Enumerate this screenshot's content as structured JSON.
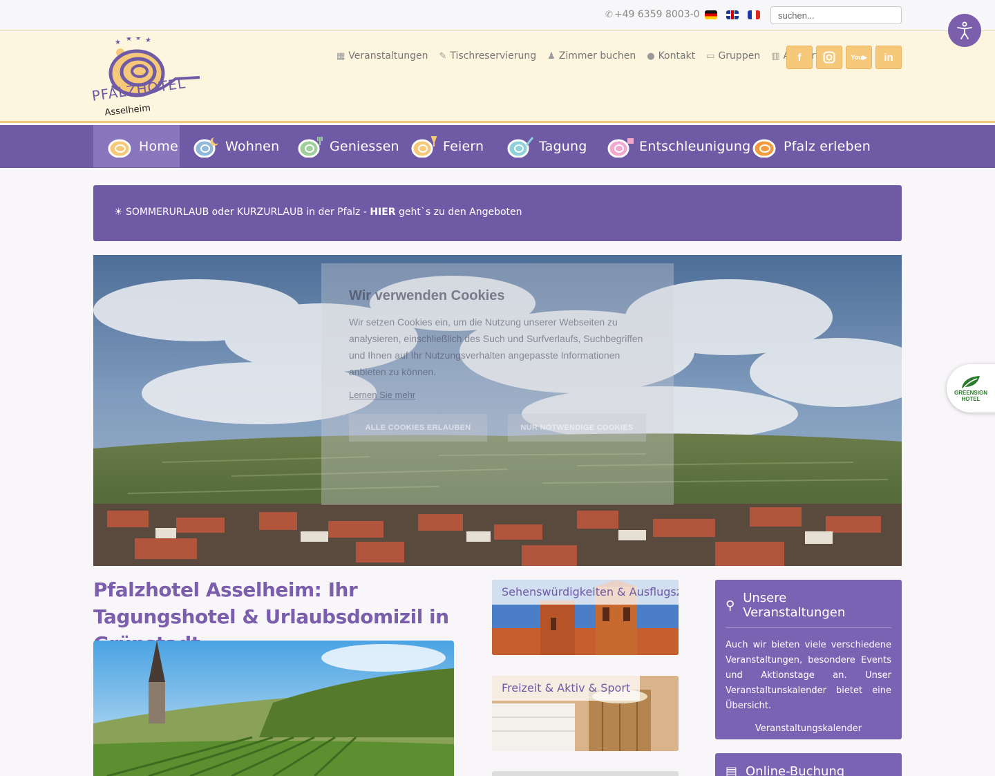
{
  "topbar": {
    "phone": "+49 6359 8003-0",
    "languages": [
      "de",
      "en",
      "fr"
    ],
    "search_placeholder": "suchen..."
  },
  "brand": {
    "line1": "PFALZHOTEL",
    "line2": "Asselheim"
  },
  "subnav": [
    {
      "label": "Veranstaltungen",
      "icon": "calendar-icon"
    },
    {
      "label": "Tischreservierung",
      "icon": "pencil-icon"
    },
    {
      "label": "Zimmer buchen",
      "icon": "user-icon"
    },
    {
      "label": "Kontakt",
      "icon": "chat-icon"
    },
    {
      "label": "Gruppen",
      "icon": "picture-icon"
    },
    {
      "label": "Anfahrt",
      "icon": "map-icon"
    }
  ],
  "social": [
    "facebook-icon",
    "instagram-icon",
    "youtube-icon",
    "linkedin-icon"
  ],
  "mainnav": [
    "Home",
    "Wohnen",
    "Geniessen",
    "Feiern",
    "Tagung",
    "Entschleunigung",
    "Pfalz erleben"
  ],
  "banner": {
    "glyph": "",
    "sun": "☀",
    "text_pre": "SOMMERURLAUB oder KURZURLAUB in der Pfalz - ",
    "text_bold": "HIER",
    "text_post": " geht`s zu den Angeboten"
  },
  "cookie": {
    "title": "Wir verwenden Cookies",
    "body": "Wir setzen Cookies ein, um die Nutzung unserer Webseiten zu analysieren, einschließlich des Such und Surfverlaufs, Suchbegriffen und Ihnen auf Ihr Nutzungsverhalten angepasste Informationen anbieten zu können.",
    "learn_more": "Lernen Sie mehr",
    "allow_all": "ALLE COOKIES ERLAUBEN",
    "necessary_only": "NUR NOTWENDIGE COOKIES"
  },
  "main": {
    "heading": "Pfalzhotel Asselheim: Ihr Tagungshotel & Urlaubsdomizil in Grünstadt"
  },
  "tiles": [
    {
      "label": "Sehenswürdigkeiten & Ausflugsziele"
    },
    {
      "label": "Freizeit & Aktiv & Sport"
    }
  ],
  "events_box": {
    "title": "Unsere Veranstaltungen",
    "text": "Auch wir bieten viele verschiedene Veranstaltungen, besondere Events und Aktionstage an. Unser Veranstaltunskalender bietet eine Übersicht.",
    "link": "Veranstaltungskalender"
  },
  "booking_box": {
    "title": "Online-Buchung"
  },
  "badge": {
    "line1": "GREENSIGN",
    "line2": "HOTEL"
  },
  "colors": {
    "purple": "#6e5aa5",
    "cream": "#fef5df",
    "orange": "#f6c87a"
  }
}
